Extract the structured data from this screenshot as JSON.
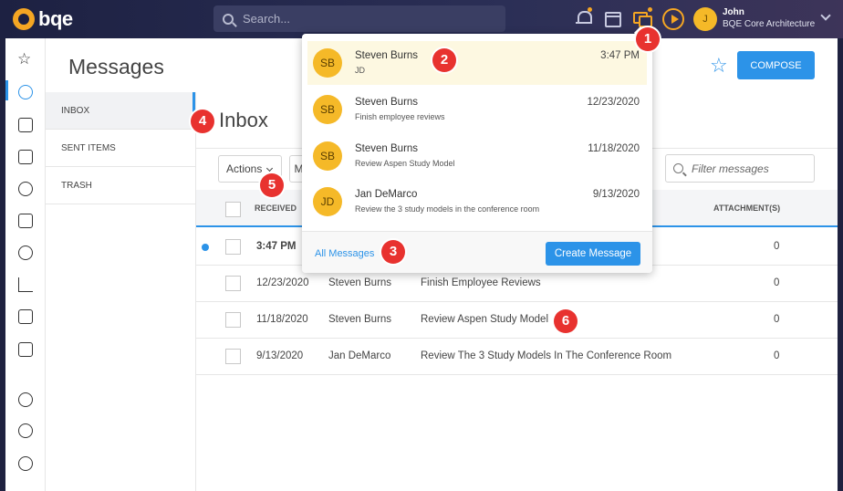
{
  "app": {
    "logo_text": "bqe"
  },
  "search": {
    "placeholder": "Search..."
  },
  "user": {
    "initial": "J",
    "name": "John",
    "org": "BQE Core Architecture"
  },
  "page": {
    "title": "Messages",
    "compose_label": "COMPOSE"
  },
  "folders": [
    {
      "label": "INBOX",
      "active": true
    },
    {
      "label": "SENT ITEMS",
      "active": false
    },
    {
      "label": "TRASH",
      "active": false
    }
  ],
  "inbox": {
    "title": "Inbox",
    "actions_label": "Actions",
    "more_label": "M",
    "filter_placeholder": "Filter messages",
    "columns": {
      "received": "RECEIVED",
      "attachments": "ATTACHMENT(S)"
    },
    "rows": [
      {
        "received": "3:47 PM",
        "sender": "",
        "subject": "",
        "attachments": "0",
        "unread": true
      },
      {
        "received": "12/23/2020",
        "sender": "Steven Burns",
        "subject": "Finish Employee Reviews",
        "attachments": "0",
        "unread": false
      },
      {
        "received": "11/18/2020",
        "sender": "Steven Burns",
        "subject": "Review Aspen Study Model",
        "attachments": "0",
        "unread": false
      },
      {
        "received": "9/13/2020",
        "sender": "Jan DeMarco",
        "subject": "Review The 3 Study Models In The Conference Room",
        "attachments": "0",
        "unread": false
      }
    ]
  },
  "dropdown": {
    "messages": [
      {
        "initials": "SB",
        "sender": "Steven Burns",
        "date": "3:47 PM",
        "preview": "JD",
        "highlight": true
      },
      {
        "initials": "SB",
        "sender": "Steven Burns",
        "date": "12/23/2020",
        "preview": "Finish employee reviews",
        "highlight": false
      },
      {
        "initials": "SB",
        "sender": "Steven Burns",
        "date": "11/18/2020",
        "preview": "Review Aspen Study Model",
        "highlight": false
      },
      {
        "initials": "JD",
        "sender": "Jan DeMarco",
        "date": "9/13/2020",
        "preview": "Review the 3 study models in the conference room",
        "highlight": false
      }
    ],
    "all_messages_label": "All Messages",
    "create_label": "Create Message"
  },
  "callouts": [
    "1",
    "2",
    "3",
    "4",
    "5",
    "6"
  ],
  "colors": {
    "accent": "#2c93e8",
    "brand": "#f5a623",
    "callout": "#e8322f",
    "avatar": "#f5b928"
  }
}
